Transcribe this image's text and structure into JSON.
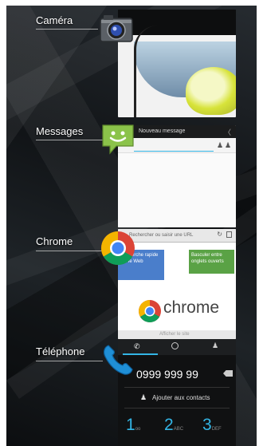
{
  "apps": [
    {
      "label": "Caméra"
    },
    {
      "label": "Messages",
      "title": "Nouveau message"
    },
    {
      "label": "Chrome",
      "omnibox_placeholder": "Rechercher ou saisir une URL",
      "tile_left": "Recherche rapide sur le Web",
      "tile_right": "Basculer entre onglets ouverts",
      "logo_word": "chrome",
      "bottom_text": "Afficher le site"
    },
    {
      "label": "Téléphone",
      "number": "0999 999 99",
      "add_contact": "Ajouter aux contacts",
      "keys": [
        "1",
        "2",
        "3"
      ],
      "key_subs": [
        "oo",
        "ABC",
        "DEF"
      ]
    }
  ],
  "colors": {
    "accent": "#33b5e5",
    "chrome_red": "#db4437",
    "chrome_green": "#0f9d58",
    "chrome_yellow": "#f4b400",
    "chrome_blue": "#4285f4",
    "messages_green": "#8bc34a"
  }
}
